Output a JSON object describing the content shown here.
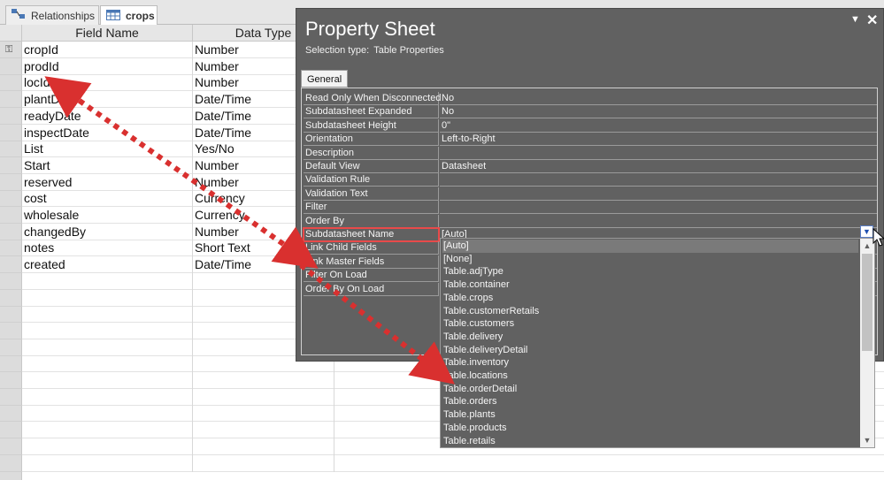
{
  "tabs": [
    {
      "label": "Relationships",
      "icon": "relationships-icon"
    },
    {
      "label": "crops",
      "icon": "table-icon"
    }
  ],
  "grid": {
    "headers": [
      "Field Name",
      "Data Type"
    ],
    "rows": [
      {
        "name": "cropId",
        "type": "Number",
        "key": true
      },
      {
        "name": "prodId",
        "type": "Number"
      },
      {
        "name": "locId",
        "type": "Number"
      },
      {
        "name": "plantDate",
        "type": "Date/Time"
      },
      {
        "name": "readyDate",
        "type": "Date/Time"
      },
      {
        "name": "inspectDate",
        "type": "Date/Time"
      },
      {
        "name": "List",
        "type": "Yes/No"
      },
      {
        "name": "Start",
        "type": "Number"
      },
      {
        "name": "reserved",
        "type": "Number"
      },
      {
        "name": "cost",
        "type": "Currency"
      },
      {
        "name": "wholesale",
        "type": "Currency"
      },
      {
        "name": "changedBy",
        "type": "Number"
      },
      {
        "name": "notes",
        "type": "Short Text"
      },
      {
        "name": "created",
        "type": "Date/Time"
      }
    ]
  },
  "property_sheet": {
    "title": "Property Sheet",
    "selection_label": "Selection type:",
    "selection_value": "Table Properties",
    "tab": "General",
    "properties": [
      {
        "label": "Read Only When Disconnected",
        "value": "No"
      },
      {
        "label": "Subdatasheet Expanded",
        "value": "No"
      },
      {
        "label": "Subdatasheet Height",
        "value": "0\""
      },
      {
        "label": "Orientation",
        "value": "Left-to-Right"
      },
      {
        "label": "Description",
        "value": ""
      },
      {
        "label": "Default View",
        "value": "Datasheet"
      },
      {
        "label": "Validation Rule",
        "value": ""
      },
      {
        "label": "Validation Text",
        "value": ""
      },
      {
        "label": "Filter",
        "value": ""
      },
      {
        "label": "Order By",
        "value": ""
      },
      {
        "label": "Subdatasheet Name",
        "value": "[Auto]",
        "highlight": true
      },
      {
        "label": "Link Child Fields",
        "value": ""
      },
      {
        "label": "Link Master Fields",
        "value": ""
      },
      {
        "label": "Filter On Load",
        "value": ""
      },
      {
        "label": "Order By On Load",
        "value": ""
      }
    ]
  },
  "dropdown": {
    "selected": "[Auto]",
    "items": [
      "[Auto]",
      "[None]",
      "Table.adjType",
      "Table.container",
      "Table.crops",
      "Table.customerRetails",
      "Table.customers",
      "Table.delivery",
      "Table.deliveryDetail",
      "Table.inventory",
      "Table.locations",
      "Table.orderDetail",
      "Table.orders",
      "Table.plants",
      "Table.products",
      "Table.retails"
    ]
  },
  "colors": {
    "arrow": "#d9302f",
    "highlight_border": "#e84a4a",
    "panel_bg": "#616161"
  }
}
